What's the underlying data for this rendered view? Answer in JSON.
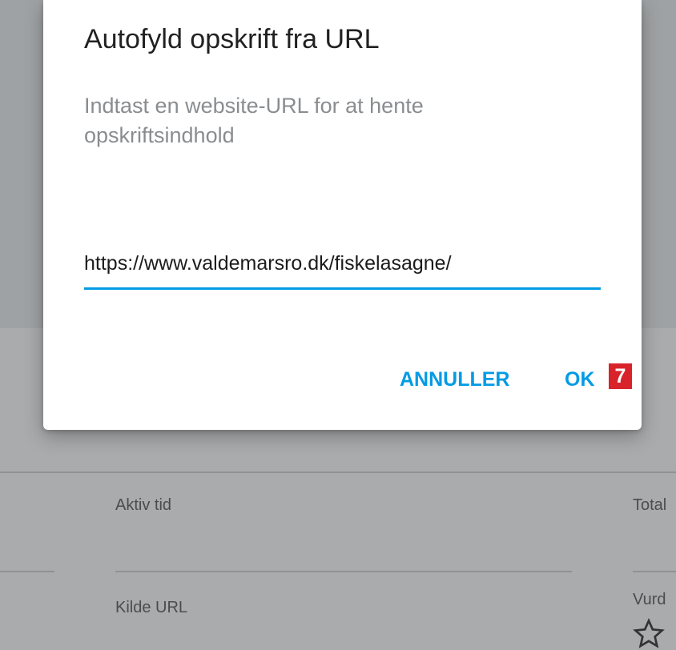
{
  "dialog": {
    "title": "Autofyld opskrift fra URL",
    "message": "Indtast en website-URL for at hente opskriftsindhold",
    "url_value": "https://www.valdemarsro.dk/fiskelasagne/",
    "cancel_label": "ANNULLER",
    "ok_label": "OK",
    "step_badge": "7"
  },
  "background": {
    "active_time_label": "Aktiv tid",
    "total_label": "Total",
    "source_url_label": "Kilde URL",
    "rating_label": "Vurd",
    "rating_icon": "star-outline-icon"
  },
  "colors": {
    "accent": "#039be5",
    "badge": "#d8232a"
  }
}
